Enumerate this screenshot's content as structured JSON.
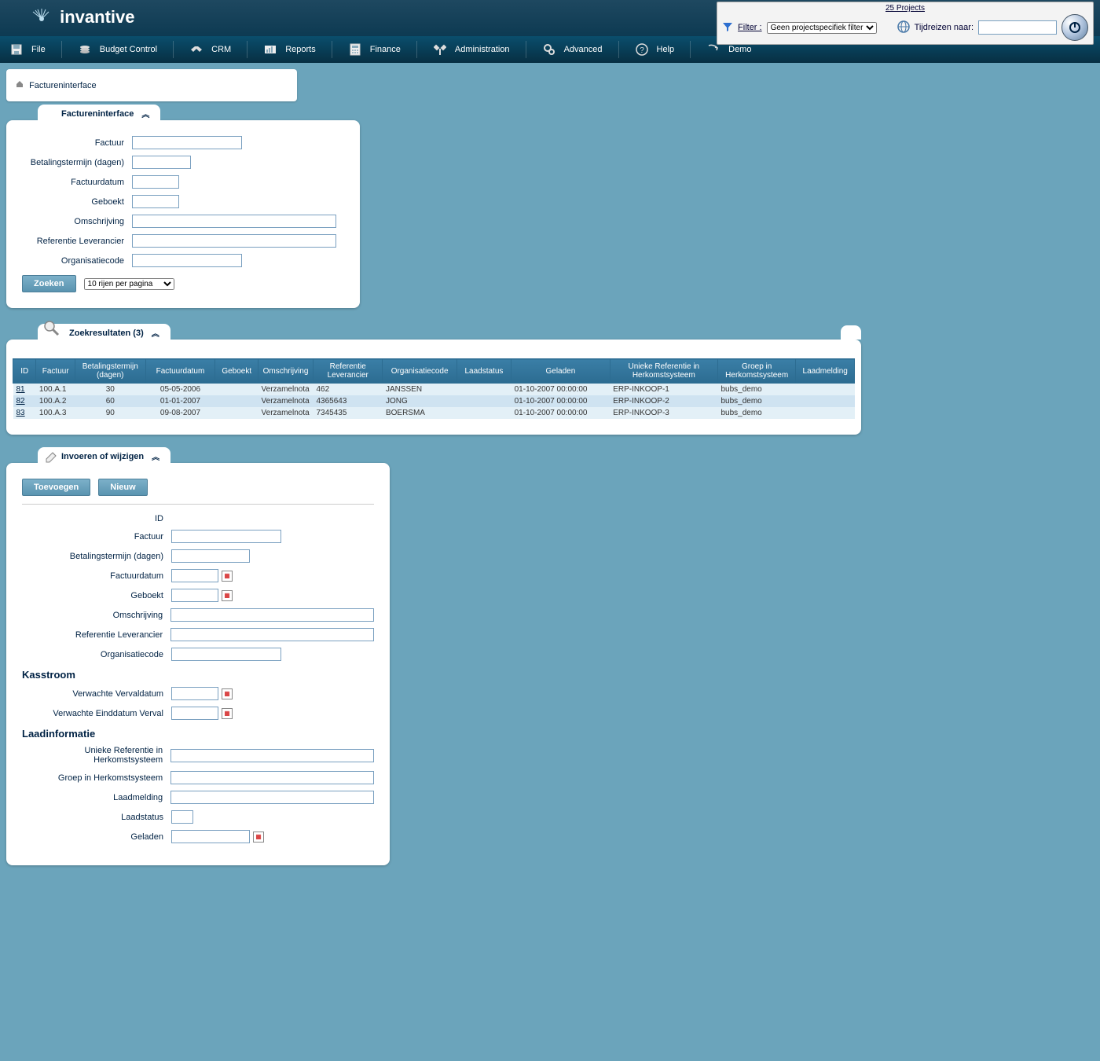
{
  "header": {
    "brand": "invantive",
    "projects_text": "25 Projects",
    "filter_label": "Filter :",
    "filter_value": "Geen projectspecifiek filter",
    "time_label": "Tijdreizen naar:"
  },
  "menu": [
    {
      "label": "File"
    },
    {
      "label": "Budget Control"
    },
    {
      "label": "CRM"
    },
    {
      "label": "Reports"
    },
    {
      "label": "Finance"
    },
    {
      "label": "Administration"
    },
    {
      "label": "Advanced"
    },
    {
      "label": "Help"
    },
    {
      "label": "Demo"
    }
  ],
  "breadcrumb": {
    "title": "Factureninterface"
  },
  "search_panel": {
    "title": "Factureninterface",
    "fields": {
      "factuur": "Factuur",
      "betalingstermijn": "Betalingstermijn (dagen)",
      "factuurdatum": "Factuurdatum",
      "geboekt": "Geboekt",
      "omschrijving": "Omschrijving",
      "ref_leverancier": "Referentie Leverancier",
      "organisatiecode": "Organisatiecode"
    },
    "search_button": "Zoeken",
    "pagesize": "10 rijen per pagina"
  },
  "results_panel": {
    "title": "Zoekresultaten (3)",
    "headers": [
      "ID",
      "Factuur",
      "Betalingstermijn (dagen)",
      "Factuurdatum",
      "Geboekt",
      "Omschrijving",
      "Referentie Leverancier",
      "Organisatiecode",
      "Laadstatus",
      "Geladen",
      "Unieke Referentie in Herkomstsysteem",
      "Groep in Herkomstsysteem",
      "Laadmelding"
    ],
    "rows": [
      {
        "id": "81",
        "factuur": "100.A.1",
        "termijn": "30",
        "datum": "05-05-2006",
        "geboekt": "",
        "omschr": "Verzamelnota",
        "ref": "462",
        "org": "JANSSEN",
        "laadstatus": "",
        "geladen": "01-10-2007 00:00:00",
        "uref": "ERP-INKOOP-1",
        "groep": "bubs_demo",
        "melding": ""
      },
      {
        "id": "82",
        "factuur": "100.A.2",
        "termijn": "60",
        "datum": "01-01-2007",
        "geboekt": "",
        "omschr": "Verzamelnota",
        "ref": "4365643",
        "org": "JONG",
        "laadstatus": "",
        "geladen": "01-10-2007 00:00:00",
        "uref": "ERP-INKOOP-2",
        "groep": "bubs_demo",
        "melding": ""
      },
      {
        "id": "83",
        "factuur": "100.A.3",
        "termijn": "90",
        "datum": "09-08-2007",
        "geboekt": "",
        "omschr": "Verzamelnota",
        "ref": "7345435",
        "org": "BOERSMA",
        "laadstatus": "",
        "geladen": "01-10-2007 00:00:00",
        "uref": "ERP-INKOOP-3",
        "groep": "bubs_demo",
        "melding": ""
      }
    ]
  },
  "edit_panel": {
    "title": "Invoeren of wijzigen",
    "buttons": {
      "add": "Toevoegen",
      "new": "Nieuw"
    },
    "fields": {
      "id": "ID",
      "factuur": "Factuur",
      "termijn": "Betalingstermijn (dagen)",
      "factuurdatum": "Factuurdatum",
      "geboekt": "Geboekt",
      "omschrijving": "Omschrijving",
      "ref": "Referentie Leverancier",
      "org": "Organisatiecode"
    },
    "kasstroom": {
      "title": "Kasstroom",
      "verwachte_verval": "Verwachte Vervaldatum",
      "verwachte_eind": "Verwachte Einddatum Verval"
    },
    "laadinfo": {
      "title": "Laadinformatie",
      "uref": "Unieke Referentie in Herkomstsysteem",
      "groep": "Groep in Herkomstsysteem",
      "melding": "Laadmelding",
      "status": "Laadstatus",
      "geladen": "Geladen"
    }
  }
}
